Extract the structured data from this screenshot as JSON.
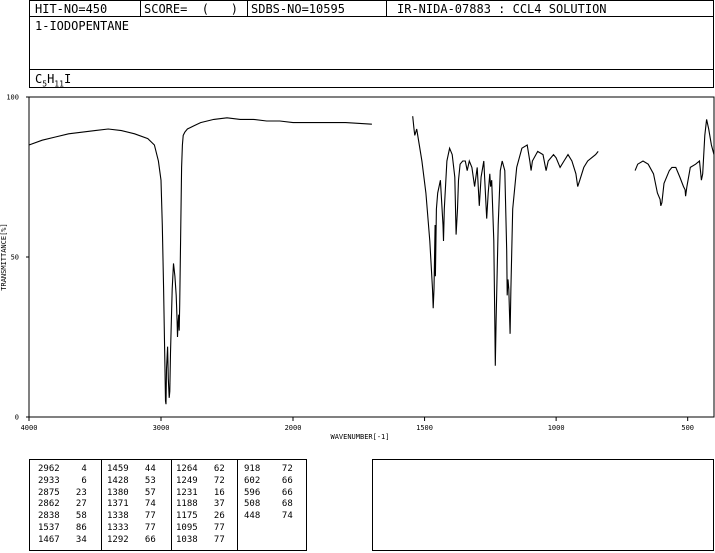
{
  "header": {
    "hit_no": "HIT-NO=450",
    "score": "SCORE=  (   )",
    "sdbs_no": "SDBS-NO=10595",
    "ir_nida": "IR-NIDA-07883 : CCL4 SOLUTION",
    "compound_name": "1-IODOPENTANE",
    "formula_c": "C",
    "formula_c_sub": "5",
    "formula_h": "H",
    "formula_h_sub": "11",
    "formula_i": "I"
  },
  "chart_data": {
    "type": "line",
    "xlabel": "WAVENUMBER[-1]",
    "ylabel": "TRANSMITTANCE[%]",
    "xlim": [
      4000,
      400
    ],
    "ylim": [
      0,
      100
    ],
    "x_ticks": [
      4000,
      3000,
      2000,
      1500,
      1000,
      500
    ],
    "y_ticks": [
      0,
      50,
      100
    ],
    "series": [
      {
        "points": [
          [
            4000,
            85
          ],
          [
            3900,
            86.5
          ],
          [
            3800,
            87.5
          ],
          [
            3700,
            88.5
          ],
          [
            3600,
            89
          ],
          [
            3500,
            89.5
          ],
          [
            3400,
            90
          ],
          [
            3300,
            89.5
          ],
          [
            3200,
            88.5
          ],
          [
            3100,
            87
          ],
          [
            3050,
            85
          ],
          [
            3020,
            80
          ],
          [
            3000,
            74
          ],
          [
            2990,
            60
          ],
          [
            2980,
            40
          ],
          [
            2972,
            20
          ],
          [
            2966,
            5
          ],
          [
            2962,
            4
          ],
          [
            2958,
            15
          ],
          [
            2950,
            22
          ],
          [
            2945,
            12
          ],
          [
            2938,
            6
          ],
          [
            2933,
            8
          ],
          [
            2928,
            20
          ],
          [
            2915,
            40
          ],
          [
            2905,
            48
          ],
          [
            2895,
            44
          ],
          [
            2885,
            38
          ],
          [
            2878,
            30
          ],
          [
            2875,
            25
          ],
          [
            2872,
            28
          ],
          [
            2866,
            32
          ],
          [
            2862,
            27
          ],
          [
            2858,
            35
          ],
          [
            2850,
            60
          ],
          [
            2844,
            78
          ],
          [
            2838,
            85
          ],
          [
            2832,
            88
          ],
          [
            2820,
            89
          ],
          [
            2800,
            90
          ],
          [
            2750,
            91
          ],
          [
            2700,
            92
          ],
          [
            2600,
            93
          ],
          [
            2500,
            93.5
          ],
          [
            2400,
            93
          ],
          [
            2300,
            93
          ],
          [
            2200,
            92.5
          ],
          [
            2100,
            92.5
          ],
          [
            2000,
            92
          ],
          [
            1900,
            92
          ],
          [
            1800,
            92
          ],
          [
            1700,
            91.5
          ],
          null,
          [
            1545,
            94
          ],
          [
            1540,
            90
          ],
          [
            1537,
            88
          ],
          [
            1530,
            90
          ],
          [
            1520,
            85
          ],
          [
            1510,
            80
          ],
          [
            1495,
            70
          ],
          [
            1480,
            55
          ],
          [
            1470,
            40
          ],
          [
            1467,
            34
          ],
          [
            1464,
            40
          ],
          [
            1460,
            60
          ],
          [
            1459,
            44
          ],
          [
            1455,
            65
          ],
          [
            1450,
            70
          ],
          [
            1440,
            74
          ],
          [
            1430,
            60
          ],
          [
            1428,
            55
          ],
          [
            1425,
            65
          ],
          [
            1415,
            80
          ],
          [
            1405,
            84
          ],
          [
            1395,
            82
          ],
          [
            1385,
            75
          ],
          [
            1380,
            57
          ],
          [
            1375,
            65
          ],
          [
            1371,
            74
          ],
          [
            1365,
            79
          ],
          [
            1355,
            80
          ],
          [
            1345,
            80
          ],
          [
            1338,
            77
          ],
          [
            1330,
            80
          ],
          [
            1320,
            78
          ],
          [
            1310,
            72
          ],
          [
            1300,
            78
          ],
          [
            1292,
            66
          ],
          [
            1285,
            75
          ],
          [
            1275,
            80
          ],
          [
            1264,
            62
          ],
          [
            1258,
            70
          ],
          [
            1252,
            76
          ],
          [
            1249,
            72
          ],
          [
            1245,
            74
          ],
          [
            1237,
            55
          ],
          [
            1233,
            30
          ],
          [
            1231,
            16
          ],
          [
            1228,
            30
          ],
          [
            1220,
            60
          ],
          [
            1212,
            77
          ],
          [
            1205,
            80
          ],
          [
            1195,
            77
          ],
          [
            1188,
            52
          ],
          [
            1186,
            38
          ],
          [
            1183,
            43
          ],
          [
            1180,
            40
          ],
          [
            1175,
            26
          ],
          [
            1172,
            40
          ],
          [
            1165,
            65
          ],
          [
            1150,
            78
          ],
          [
            1130,
            84
          ],
          [
            1110,
            85
          ],
          [
            1100,
            80
          ],
          [
            1095,
            77
          ],
          [
            1090,
            80
          ],
          [
            1070,
            83
          ],
          [
            1050,
            82
          ],
          [
            1038,
            77
          ],
          [
            1030,
            80
          ],
          [
            1010,
            82
          ],
          [
            1000,
            81
          ],
          [
            985,
            78
          ],
          [
            970,
            80
          ],
          [
            955,
            82
          ],
          [
            940,
            80
          ],
          [
            925,
            76
          ],
          [
            918,
            72
          ],
          [
            910,
            74
          ],
          [
            895,
            78
          ],
          [
            880,
            80
          ],
          [
            865,
            81
          ],
          [
            850,
            82
          ],
          [
            840,
            83
          ],
          null,
          [
            700,
            77
          ],
          [
            690,
            79
          ],
          [
            670,
            80
          ],
          [
            650,
            79
          ],
          [
            630,
            76
          ],
          [
            615,
            70
          ],
          [
            605,
            68
          ],
          [
            602,
            66
          ],
          [
            598,
            67
          ],
          [
            590,
            73
          ],
          [
            570,
            77
          ],
          [
            560,
            78
          ],
          [
            545,
            78
          ],
          [
            530,
            75
          ],
          [
            516,
            72
          ],
          [
            510,
            71
          ],
          [
            508,
            69
          ],
          [
            503,
            72
          ],
          [
            490,
            78
          ],
          [
            470,
            79
          ],
          [
            455,
            80
          ],
          [
            448,
            74
          ],
          [
            443,
            76
          ],
          [
            435,
            88
          ],
          [
            428,
            93
          ],
          [
            420,
            90
          ],
          [
            410,
            85
          ],
          [
            400,
            82
          ]
        ]
      }
    ]
  },
  "peak_table": [
    [
      [
        "2962",
        "4"
      ],
      [
        "2933",
        "6"
      ],
      [
        "2875",
        "23"
      ],
      [
        "2862",
        "27"
      ],
      [
        "2838",
        "58"
      ],
      [
        "1537",
        "86"
      ],
      [
        "1467",
        "34"
      ]
    ],
    [
      [
        "1459",
        "44"
      ],
      [
        "1428",
        "53"
      ],
      [
        "1380",
        "57"
      ],
      [
        "1371",
        "74"
      ],
      [
        "1338",
        "77"
      ],
      [
        "1333",
        "77"
      ],
      [
        "1292",
        "66"
      ]
    ],
    [
      [
        "1264",
        "62"
      ],
      [
        "1249",
        "72"
      ],
      [
        "1231",
        "16"
      ],
      [
        "1188",
        "37"
      ],
      [
        "1175",
        "26"
      ],
      [
        "1095",
        "77"
      ],
      [
        "1038",
        "77"
      ]
    ],
    [
      [
        "918",
        "72"
      ],
      [
        "602",
        "66"
      ],
      [
        "596",
        "66"
      ],
      [
        "508",
        "68"
      ],
      [
        "448",
        "74"
      ]
    ]
  ]
}
